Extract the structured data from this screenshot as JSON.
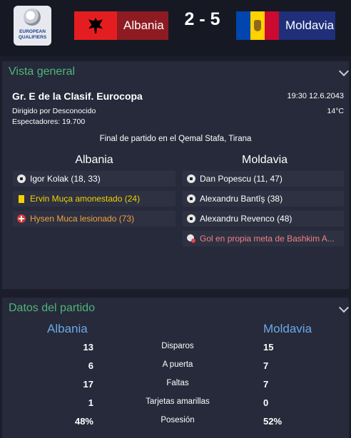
{
  "header": {
    "logo_text": "EUROPEAN QUALIFIERS",
    "home_team": "Albania",
    "away_team": "Moldavia",
    "score": "2 - 5",
    "home_color": "#8e1b22",
    "away_color": "#1f2f7a"
  },
  "overview": {
    "title": "Vista general",
    "competition": "Gr. E de la Clasif. Eurocopa",
    "datetime": "19:30 12.6.2043",
    "referee": "Dirigido por Desconocido",
    "temperature": "14°C",
    "attendance": "Espectadores: 19.700",
    "venue": "Final de partido en el Qemal Stafa, Tirana",
    "home_title": "Albania",
    "away_title": "Moldavia",
    "home_events": [
      {
        "icon": "goal-ball-icon",
        "text": "Igor Kolak (18, 33)"
      },
      {
        "icon": "yellow-card-icon",
        "text": "Ervin Muça amonestado (24)"
      },
      {
        "icon": "injury-icon",
        "text": "Hysen Muca lesionado (73)"
      }
    ],
    "away_events": [
      {
        "icon": "goal-ball-icon",
        "text": "Dan Popescu (11, 47)"
      },
      {
        "icon": "goal-ball-icon",
        "text": "Alexandru Bantîş (38)"
      },
      {
        "icon": "goal-ball-icon",
        "text": "Alexandru Revenco (48)"
      },
      {
        "icon": "own-goal-icon",
        "text": "Gol en propia meta de Bashkim A..."
      }
    ]
  },
  "stats": {
    "title": "Datos del partido",
    "home_team": "Albania",
    "away_team": "Moldavia",
    "rows": [
      {
        "label": "Disparos",
        "home": "13",
        "away": "15"
      },
      {
        "label": "A puerta",
        "home": "6",
        "away": "7"
      },
      {
        "label": "Faltas",
        "home": "17",
        "away": "7"
      },
      {
        "label": "Tarjetas amarillas",
        "home": "1",
        "away": "0"
      },
      {
        "label": "Posesión",
        "home": "48%",
        "away": "52%"
      }
    ]
  }
}
